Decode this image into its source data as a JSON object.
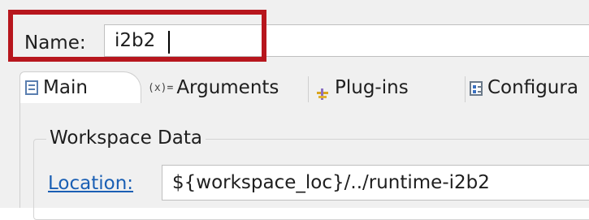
{
  "name_row": {
    "label": "Name:",
    "value": "i2b2",
    "highlight_color": "#b7161d"
  },
  "tabs": [
    {
      "label": "Main",
      "icon": "main-tab-icon",
      "selected": true
    },
    {
      "label": "Arguments",
      "icon": "arguments-icon",
      "icon_glyph": "(x)=",
      "selected": false
    },
    {
      "label": "Plug-ins",
      "icon": "plugin-icon",
      "selected": false
    },
    {
      "label": "Configura",
      "icon": "configuration-icon",
      "selected": false
    }
  ],
  "workspace": {
    "group_title": "Workspace Data",
    "location_label": "Location:",
    "location_value": "${workspace_loc}/../runtime-i2b2",
    "link_color": "#1a5fb4"
  }
}
